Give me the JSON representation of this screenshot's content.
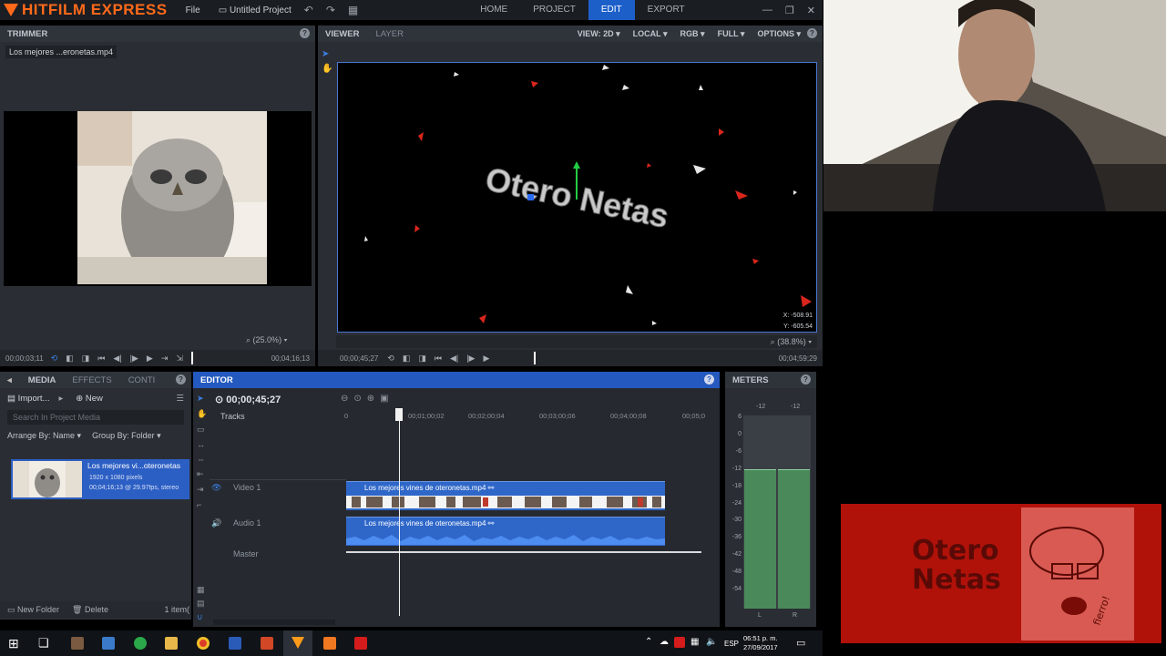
{
  "app": {
    "name": "HITFILM EXPRESS",
    "menu_file": "File",
    "project_name": "Untitled Project",
    "tabs": [
      "HOME",
      "PROJECT",
      "EDIT",
      "EXPORT"
    ],
    "active_tab": "EDIT"
  },
  "trimmer": {
    "title": "TRIMMER",
    "filename": "Los mejores ...eronetas.mp4",
    "zoom": "(25.0%)",
    "time_left": "00;00;03;11",
    "time_right": "00;04;16;13"
  },
  "viewer": {
    "tabs": [
      "VIEWER",
      "LAYER"
    ],
    "options": [
      "VIEW: 2D",
      "LOCAL",
      "RGB",
      "FULL",
      "OPTIONS"
    ],
    "title_text": "Otero Netas",
    "coord_x": "X:   -508.91",
    "coord_y": "Y:   -605.54",
    "zoom": "(38.8%)",
    "time_left": "00;00;45;27",
    "time_right": "00;04;59;29"
  },
  "media": {
    "tabs": [
      "MEDIA",
      "EFFECTS",
      "CONTI"
    ],
    "import_label": "Import...",
    "new_label": "New",
    "search_placeholder": "Search In Project Media",
    "arrange_label": "Arrange By: Name",
    "group_label": "Group By: Folder",
    "item_name": "Los mejores vi...oteronetas",
    "item_res": "1920 x 1080 pixels",
    "item_info": "00;04;16;13 @ 29.97fps, stereo",
    "new_folder": "New Folder",
    "delete": "Delete",
    "item_count": "1 item("
  },
  "editor": {
    "title": "EDITOR",
    "timecode": "00;00;45;27",
    "tracks_label": "Tracks",
    "ruler": [
      "0",
      "00;01;00;02",
      "00;02;00;04",
      "00;03;00;06",
      "00;04;00;08",
      "00;05;0"
    ],
    "video_track": "Video 1",
    "audio_track": "Audio 1",
    "master_track": "Master",
    "video_clip": "Los mejores vines de oteronetas.mp4",
    "audio_clip": "Los mejores vines de oteronetas.mp4"
  },
  "meters": {
    "title": "METERS",
    "top_left": "-12",
    "top_right": "-12",
    "scale": [
      "6",
      "0",
      "-6",
      "-12",
      "-18",
      "-24",
      "-30",
      "-36",
      "-42",
      "-48",
      "-54"
    ],
    "channels": [
      "L",
      "R"
    ],
    "level_left_db": -12,
    "level_right_db": -12
  },
  "overlay_logo": {
    "text_line1": "Otero",
    "text_line2": "Netas",
    "signature": "fierro!"
  },
  "taskbar": {
    "language": "ESP",
    "time": "06:51 p. m.",
    "date": "27/09/2017"
  },
  "colors": {
    "accent": "#2459bf",
    "brand": "#ff6a1a",
    "clip": "#2f67c9",
    "logo_red": "#b0120a"
  }
}
